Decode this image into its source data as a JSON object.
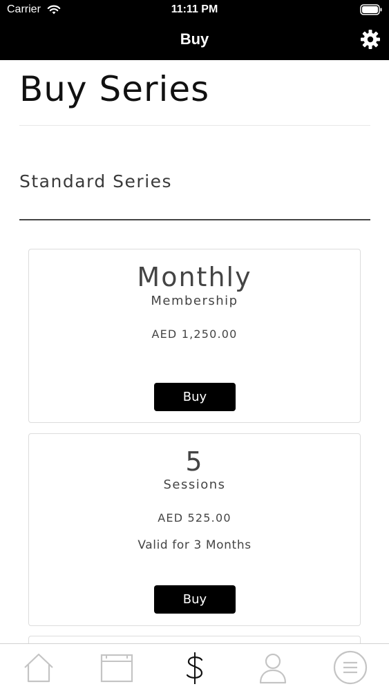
{
  "status_bar": {
    "carrier": "Carrier",
    "time": "11:11 PM"
  },
  "nav": {
    "title": "Buy",
    "settings_icon": "gear-icon"
  },
  "page": {
    "title": "Buy Series",
    "section_title": "Standard Series"
  },
  "cards": [
    {
      "title": "Monthly",
      "subtitle": "Membership",
      "price": "AED 1,250.00",
      "validity": "",
      "button_label": "Buy"
    },
    {
      "title": "5",
      "subtitle": "Sessions",
      "price": "AED 525.00",
      "validity": "Valid for 3 Months",
      "button_label": "Buy"
    }
  ],
  "tabbar": {
    "items": [
      {
        "icon": "home-icon",
        "selected": false
      },
      {
        "icon": "calendar-icon",
        "selected": false
      },
      {
        "icon": "dollar-icon",
        "selected": true
      },
      {
        "icon": "profile-icon",
        "selected": false
      },
      {
        "icon": "menu-icon",
        "selected": false
      }
    ]
  },
  "colors": {
    "nav_background": "#000000",
    "button_background": "#000000",
    "tab_icon_inactive": "#c4c4c4",
    "tab_icon_active": "#111111"
  }
}
